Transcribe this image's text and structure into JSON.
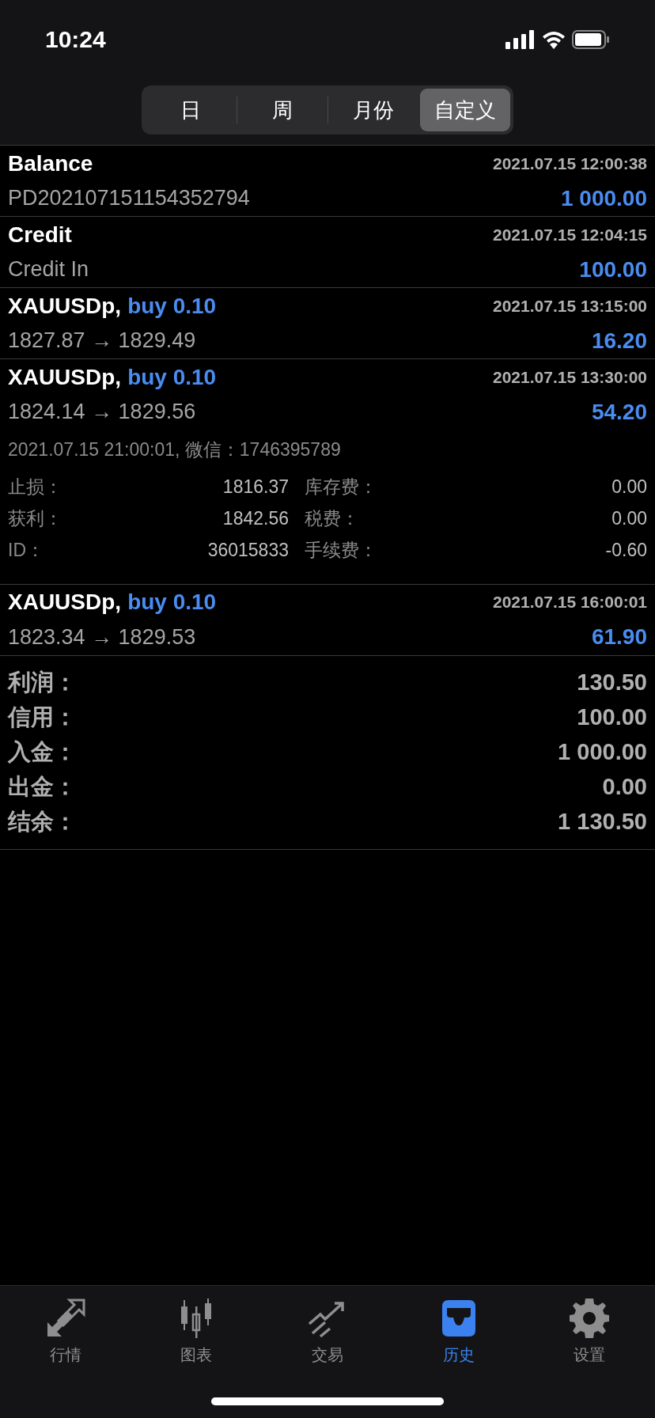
{
  "status_bar": {
    "time": "10:24"
  },
  "period_tabs": [
    {
      "label": "日",
      "selected": false
    },
    {
      "label": "周",
      "selected": false
    },
    {
      "label": "月份",
      "selected": false
    },
    {
      "label": "自定义",
      "selected": true
    }
  ],
  "history": [
    {
      "kind": "operation",
      "title": "Balance",
      "time": "2021.07.15 12:00:38",
      "subtitle": "PD202107151154352794",
      "amount": "1 000.00"
    },
    {
      "kind": "operation",
      "title": "Credit",
      "time": "2021.07.15 12:04:15",
      "subtitle": "Credit In",
      "amount": "100.00"
    },
    {
      "kind": "trade",
      "symbol": "XAUUSDp,",
      "side": "buy 0.10",
      "time": "2021.07.15 13:15:00",
      "prices": "1827.87 → 1829.49",
      "amount": "16.20"
    },
    {
      "kind": "trade",
      "symbol": "XAUUSDp,",
      "side": "buy 0.10",
      "time": "2021.07.15 13:30:00",
      "prices": "1824.14 → 1829.56",
      "amount": "54.20",
      "details": {
        "close_line": "2021.07.15 21:00:01, 微信：1746395789",
        "fields": [
          {
            "label": "止损：",
            "value": "1816.37",
            "label2": "库存费：",
            "value2": "0.00"
          },
          {
            "label": "获利：",
            "value": "1842.56",
            "label2": "税费：",
            "value2": "0.00"
          },
          {
            "label": "ID：",
            "value": "36015833",
            "label2": "手续费：",
            "value2": "-0.60"
          }
        ]
      }
    },
    {
      "kind": "trade",
      "symbol": "XAUUSDp,",
      "side": "buy 0.10",
      "time": "2021.07.15 16:00:01",
      "prices": "1823.34 → 1829.53",
      "amount": "61.90"
    }
  ],
  "summary": [
    {
      "label": "利润：",
      "value": "130.50"
    },
    {
      "label": "信用：",
      "value": "100.00"
    },
    {
      "label": "入金：",
      "value": "1 000.00"
    },
    {
      "label": "出金：",
      "value": "0.00"
    },
    {
      "label": "结余：",
      "value": "1 130.50"
    }
  ],
  "tab_bar": [
    {
      "label": "行情",
      "selected": false
    },
    {
      "label": "图表",
      "selected": false
    },
    {
      "label": "交易",
      "selected": false
    },
    {
      "label": "历史",
      "selected": true
    },
    {
      "label": "设置",
      "selected": false
    }
  ]
}
